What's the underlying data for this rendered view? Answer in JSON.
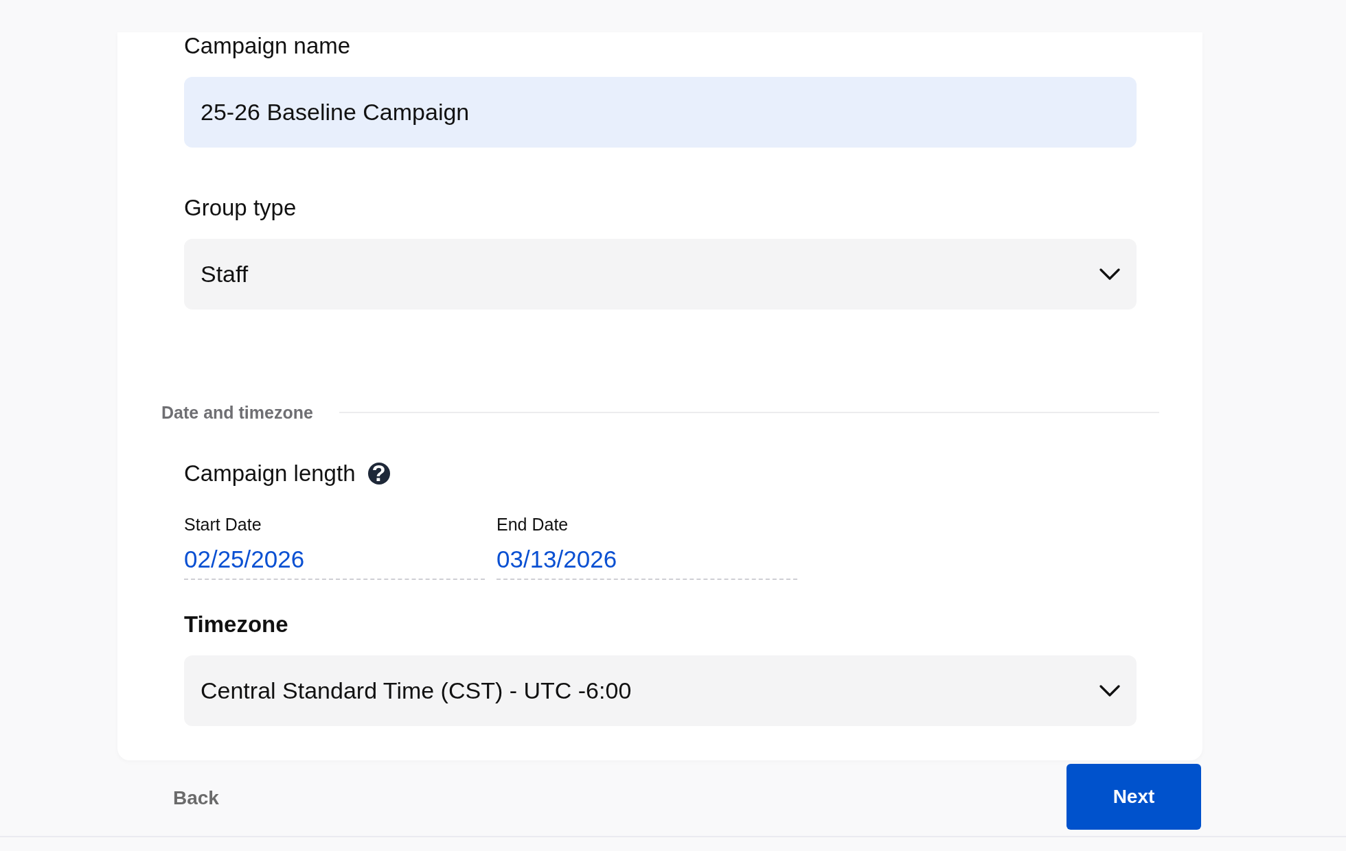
{
  "fields": [
    {
      "kind": "text",
      "label": "Campaign name",
      "value": "25-26 Baseline Campaign"
    },
    {
      "kind": "select",
      "label": "Group type",
      "value": "Staff"
    }
  ],
  "section": {
    "title": "Date and timezone",
    "campaign_length": {
      "label": "Campaign length",
      "help": "?"
    },
    "dates": [
      {
        "label": "Start Date",
        "value": "02/25/2026"
      },
      {
        "label": "End Date",
        "value": "03/13/2026"
      }
    ],
    "timezone": {
      "label": "Timezone",
      "value": "Central Standard Time (CST) - UTC -6:00"
    }
  },
  "footer": {
    "back": "Back",
    "next": "Next"
  }
}
